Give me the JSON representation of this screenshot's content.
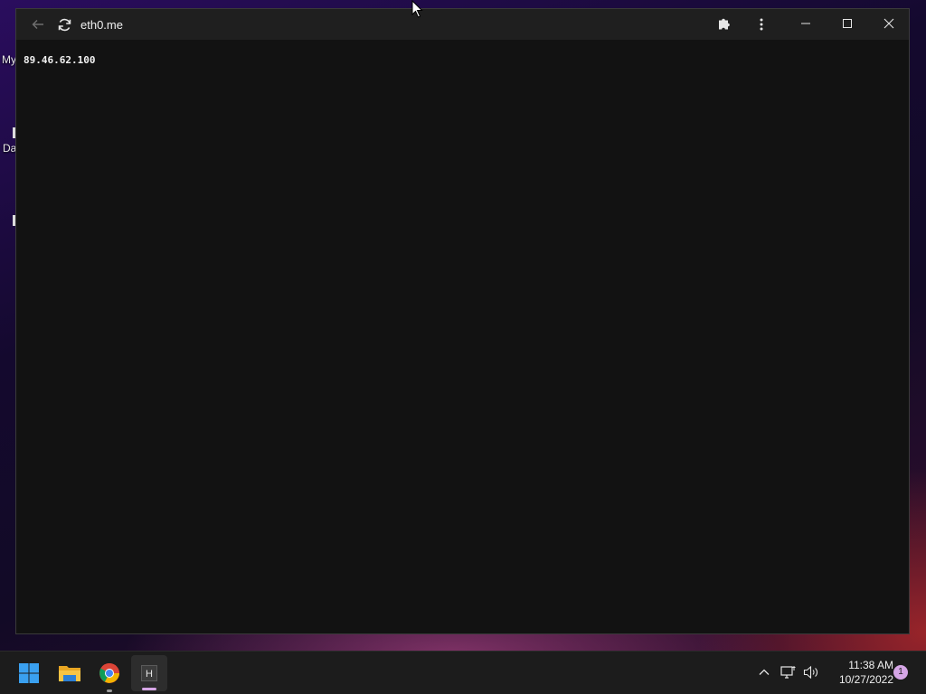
{
  "desktop": {
    "icon_labels": [
      "My",
      "Da"
    ]
  },
  "browser": {
    "url": "eth0.me",
    "back_icon": "arrow-left-icon",
    "reload_icon": "refresh-icon",
    "extensions_icon": "puzzle-icon",
    "menu_icon": "kebab-menu-icon",
    "controls": [
      "minimize-icon",
      "maximize-icon",
      "close-icon"
    ],
    "page_text": "89.46.62.100"
  },
  "taskbar": {
    "apps": [
      "windows-start-icon",
      "file-explorer-icon",
      "chrome-icon",
      "h-app-icon"
    ],
    "tray": [
      "chevron-up-icon",
      "network-icon",
      "volume-icon"
    ],
    "time": "11:38 AM",
    "date": "10/27/2022",
    "notification_count": "1"
  },
  "colors": {
    "window_bg": "#121212",
    "titlebar_bg": "#1f1f1f",
    "taskbar_bg": "#1c1c1c",
    "badge": "#d6a6e6"
  }
}
